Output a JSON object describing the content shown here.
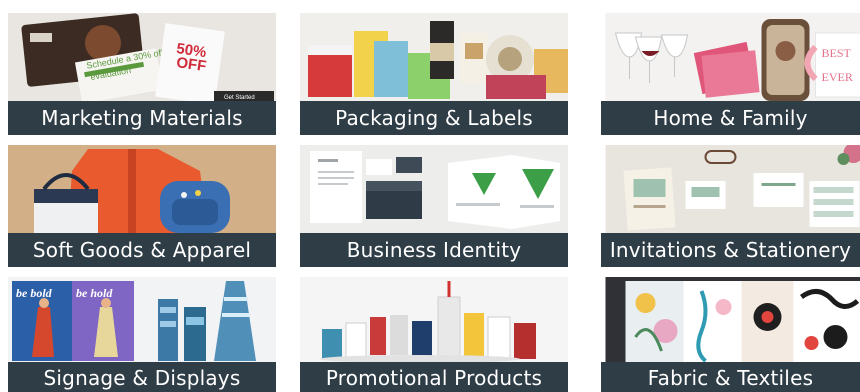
{
  "categories": [
    {
      "label": "Marketing Materials",
      "image": "printed-flyers-and-postcards",
      "img_text": [
        "Schedule a 30% off evaluation",
        "50% OFF",
        "Get Started"
      ]
    },
    {
      "label": "Packaging & Labels",
      "image": "boxes-bottles-and-labels"
    },
    {
      "label": "Home & Family",
      "image": "wine-glasses-photo-case-and-mug",
      "img_text": [
        "BEST",
        "EVER"
      ]
    },
    {
      "label": "Soft Goods & Apparel",
      "image": "jacket-tote-bag-and-backpack"
    },
    {
      "label": "Business Identity",
      "image": "letterhead-cards-and-brochure"
    },
    {
      "label": "Invitations & Stationery",
      "image": "invitation-cards-and-address-labels"
    },
    {
      "label": "Signage & Displays",
      "image": "backdrop-banners-and-racks",
      "img_text": [
        "be bold",
        "be bold"
      ]
    },
    {
      "label": "Promotional Products",
      "image": "mugs-bottles-and-tumblers"
    },
    {
      "label": "Fabric & Textiles",
      "image": "floral-printed-fabrics"
    }
  ],
  "colors": {
    "caption_bg": "#2f3d47",
    "caption_text": "#ffffff"
  }
}
